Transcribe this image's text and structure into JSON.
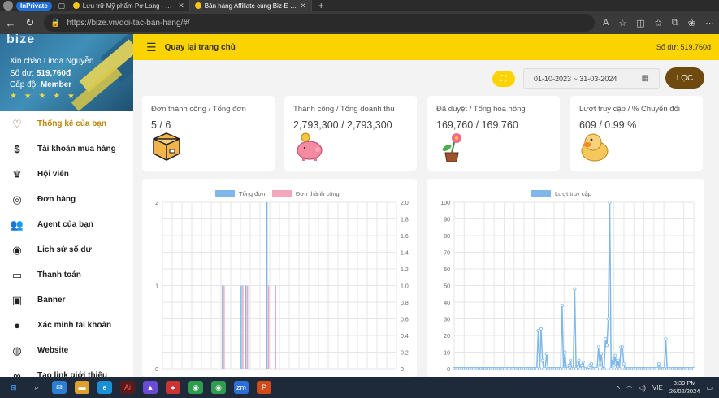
{
  "browser": {
    "inprivate_label": "InPrivate",
    "tabs": [
      {
        "title": "Lưu trữ Mỹ phẩm Pơ Lang - Biz-E",
        "active": false
      },
      {
        "title": "Bán hàng Affiliate cùng Biz-E khô",
        "active": true
      }
    ],
    "url": "https://bize.vn/doi-tac-ban-hang/#/"
  },
  "profile": {
    "logo": "bize",
    "hello": "Xin chào Linda Nguyễn",
    "balance_label": "Số dư:",
    "balance": "519,760đ",
    "level_label": "Cấp độ:",
    "level": "Member",
    "stars": "★ ★ ★ ★ ★"
  },
  "sidebar": {
    "items": [
      {
        "label": "Thống kê của bạn",
        "icon": "heart-icon",
        "glyph": "♡",
        "active": true
      },
      {
        "label": "Tài khoản mua hàng",
        "icon": "dollar-doc-icon",
        "glyph": "$"
      },
      {
        "label": "Hội viên",
        "icon": "crown-icon",
        "glyph": "♛"
      },
      {
        "label": "Đơn hàng",
        "icon": "order-icon",
        "glyph": "◎"
      },
      {
        "label": "Agent của bạn",
        "icon": "agents-icon",
        "glyph": "👥"
      },
      {
        "label": "Lịch sử số dư",
        "icon": "fingerprint-icon",
        "glyph": "◉"
      },
      {
        "label": "Thanh toán",
        "icon": "card-icon",
        "glyph": "▭"
      },
      {
        "label": "Banner",
        "icon": "image-icon",
        "glyph": "▣"
      },
      {
        "label": "Xác minh tài khoản",
        "icon": "user-icon",
        "glyph": "●"
      },
      {
        "label": "Website",
        "icon": "web-search-icon",
        "glyph": "◍"
      },
      {
        "label": "Tạo link giới thiệu",
        "icon": "link-icon",
        "glyph": "∞"
      }
    ]
  },
  "header": {
    "back_label": "Quay lại trang chủ",
    "balance": "Số dư: 519,760đ"
  },
  "filter": {
    "date_range": "01-10-2023 ~ 31-03-2024",
    "button": "LỌC"
  },
  "stats": [
    {
      "label": "Đơn thành công / Tổng đơn",
      "value": "5 / 6",
      "icon": "box-icon"
    },
    {
      "label": "Thành công / Tổng doanh thu",
      "value": "2,793,300 / 2,793,300",
      "icon": "piggy-bank-icon"
    },
    {
      "label": "Đã duyệt / Tổng hoa hồng",
      "value": "169,760 / 169,760",
      "icon": "flower-pot-icon"
    },
    {
      "label": "Lượt truy cập / % Chuyển đổi",
      "value": "609 / 0.99 %",
      "icon": "duck-icon"
    }
  ],
  "chart_data": [
    {
      "type": "bar",
      "series": [
        {
          "name": "Tổng đơn",
          "color": "#7fb8e8",
          "axis": "left",
          "x_positions": [
            0.26,
            0.34,
            0.36,
            0.45
          ],
          "values": [
            1,
            1,
            1,
            2
          ]
        },
        {
          "name": "Đơn thành công",
          "color": "#f4a7bc",
          "axis": "right",
          "x_positions": [
            0.26,
            0.34,
            0.36,
            0.45,
            0.48
          ],
          "values": [
            1,
            1,
            1,
            1,
            1
          ]
        }
      ],
      "ylim_left": [
        0,
        2
      ],
      "yticks_left": [
        "0",
        "1",
        "2"
      ],
      "ylim_right": [
        0,
        2
      ],
      "yticks_right": [
        "0",
        "0.2",
        "0.4",
        "0.6",
        "0.8",
        "1.0",
        "1.2",
        "1.4",
        "1.6",
        "1.8",
        "2.0"
      ],
      "grid": true,
      "legend": "top"
    },
    {
      "type": "line",
      "series": [
        {
          "name": "Lượt truy cập",
          "color": "#7fb8e8",
          "values": [
            0,
            0,
            0,
            0,
            0,
            0,
            0,
            0,
            0,
            0,
            0,
            0,
            0,
            0,
            0,
            0,
            0,
            0,
            0,
            0,
            0,
            0,
            0,
            0,
            0,
            0,
            0,
            0,
            0,
            0,
            0,
            0,
            0,
            0,
            0,
            0,
            0,
            0,
            0,
            0,
            0,
            0,
            0,
            0,
            0,
            0,
            0,
            0,
            0,
            0,
            0,
            0,
            0,
            0,
            0,
            0,
            0,
            0,
            0,
            0,
            23,
            0,
            24,
            5,
            0,
            0,
            9,
            0,
            0,
            0,
            0,
            0,
            0,
            0,
            0,
            0,
            0,
            38,
            0,
            10,
            0,
            0,
            2,
            5,
            0,
            0,
            48,
            0,
            3,
            5,
            0,
            2,
            4,
            0,
            0,
            0,
            1,
            2,
            3,
            0,
            0,
            0,
            0,
            13,
            2,
            9,
            0,
            0,
            18,
            14,
            30,
            100,
            0,
            6,
            2,
            8,
            0,
            5,
            0,
            13,
            13,
            3,
            0,
            0,
            0,
            0,
            0,
            0,
            0,
            0,
            0,
            0,
            0,
            0,
            0,
            0,
            0,
            0,
            0,
            0,
            0,
            0,
            0,
            0,
            0,
            0,
            3,
            0,
            0,
            0,
            0,
            18,
            0,
            0,
            0,
            0,
            0,
            0,
            0,
            0,
            0,
            0,
            0,
            0,
            0,
            0,
            0,
            0,
            0,
            0,
            0,
            0
          ]
        }
      ],
      "ylim": [
        0,
        100
      ],
      "yticks": [
        "0",
        "10",
        "20",
        "30",
        "40",
        "50",
        "60",
        "70",
        "80",
        "90",
        "100"
      ],
      "grid": true,
      "legend": "top"
    }
  ],
  "taskbar": {
    "time": "8:39 PM",
    "date": "26/02/2024",
    "lang": "VIE"
  }
}
